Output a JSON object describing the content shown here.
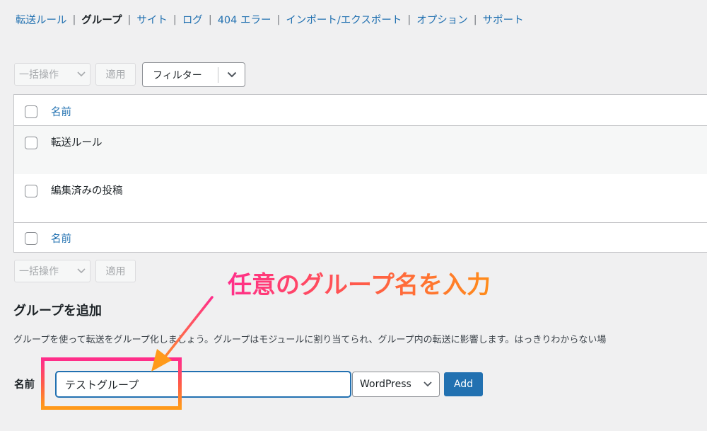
{
  "subnav": {
    "items": [
      {
        "label": "転送ルール",
        "current": false
      },
      {
        "label": "グループ",
        "current": true
      },
      {
        "label": "サイト",
        "current": false
      },
      {
        "label": "ログ",
        "current": false
      },
      {
        "label": "404 エラー",
        "current": false
      },
      {
        "label": "インポート/エクスポート",
        "current": false
      },
      {
        "label": "オプション",
        "current": false
      },
      {
        "label": "サポート",
        "current": false
      }
    ],
    "separator": "|"
  },
  "toolbar_top": {
    "bulk_label": "一括操作",
    "apply_label": "適用",
    "filter_label": "フィルター"
  },
  "table": {
    "header": "名前",
    "rows": [
      "転送ルール",
      "編集済みの投稿"
    ],
    "footer": "名前"
  },
  "toolbar_bottom": {
    "bulk_label": "一括操作",
    "apply_label": "適用"
  },
  "annotation": {
    "text": "任意のグループ名を入力"
  },
  "add_group": {
    "title": "グループを追加",
    "description": "グループを使って転送をグループ化しましょう。グループはモジュールに割り当てられ、グループ内の転送に影響します。はっきりわからない場",
    "name_label": "名前",
    "name_value": "テストグループ",
    "module_selected": "WordPress",
    "add_label": "Add"
  },
  "colors": {
    "link": "#2271b1",
    "primary": "#2271b1",
    "annotation_start": "#ff2e8a",
    "annotation_end": "#ff9a1a"
  }
}
